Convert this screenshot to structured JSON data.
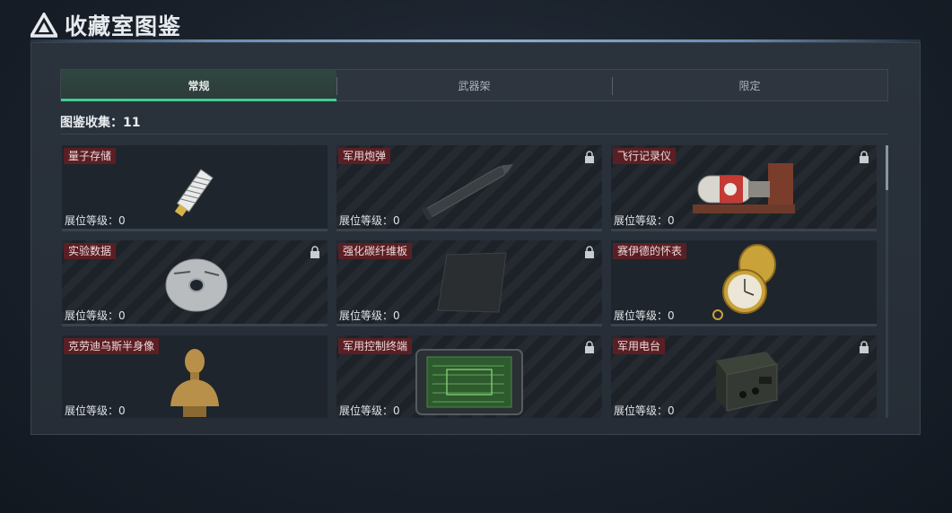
{
  "header": {
    "title": "收藏室图鉴",
    "logo_icon": "triangle-logo-icon"
  },
  "tabs": [
    {
      "label": "常规",
      "active": true
    },
    {
      "label": "武器架",
      "active": false
    },
    {
      "label": "限定",
      "active": false
    }
  ],
  "collection": {
    "label": "图鉴收集：11"
  },
  "level_label": "展位等级：0",
  "items": [
    {
      "name": "量子存储",
      "locked": false,
      "icon": "usb-drive-icon"
    },
    {
      "name": "军用炮弹",
      "locked": true,
      "icon": "artillery-shell-icon"
    },
    {
      "name": "飞行记录仪",
      "locked": true,
      "icon": "flight-recorder-icon"
    },
    {
      "name": "实验数据",
      "locked": true,
      "icon": "disc-icon"
    },
    {
      "name": "强化碳纤维板",
      "locked": true,
      "icon": "carbon-plate-icon"
    },
    {
      "name": "赛伊德的怀表",
      "locked": false,
      "icon": "pocket-watch-icon"
    },
    {
      "name": "克劳迪乌斯半身像",
      "locked": false,
      "icon": "bust-statue-icon"
    },
    {
      "name": "军用控制终端",
      "locked": true,
      "icon": "control-terminal-icon"
    },
    {
      "name": "军用电台",
      "locked": true,
      "icon": "military-radio-icon"
    }
  ],
  "colors": {
    "accent": "#3fcf8e",
    "tag_bg": "#5a1f24"
  }
}
